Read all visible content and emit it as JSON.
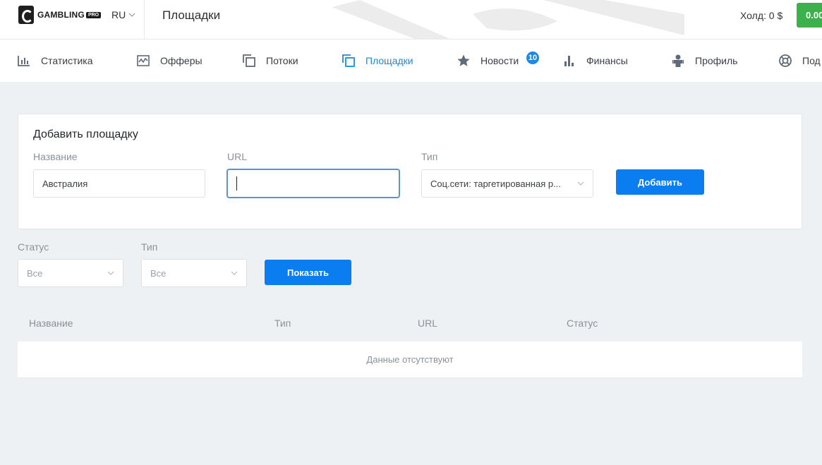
{
  "header": {
    "logo_text": "GAMBLING",
    "logo_badge": "PRO",
    "lang": "RU",
    "page_title": "Площадки",
    "hold": "Холд: 0 $",
    "balance": "0.00"
  },
  "nav": {
    "items": [
      {
        "label": "Статистика",
        "icon": "bar-chart-icon"
      },
      {
        "label": "Офферы",
        "icon": "chart-window-icon"
      },
      {
        "label": "Потоки",
        "icon": "copy-squares-icon"
      },
      {
        "label": "Площадки",
        "icon": "copy-squares-icon",
        "active": true
      },
      {
        "label": "Новости",
        "icon": "star-icon",
        "badge": "10"
      },
      {
        "label": "Финансы",
        "icon": "bars-icon"
      },
      {
        "label": "Профиль",
        "icon": "user-icon"
      },
      {
        "label": "Под",
        "icon": "lifebuoy-icon"
      }
    ]
  },
  "add_form": {
    "title": "Добавить площадку",
    "name_label": "Название",
    "name_value": "Австралия",
    "url_label": "URL",
    "url_value": "",
    "type_label": "Тип",
    "type_value": "Соц.сети: таргетированная р...",
    "submit": "Добавить"
  },
  "filters": {
    "status_label": "Статус",
    "status_value": "Все",
    "type_label": "Тип",
    "type_value": "Все",
    "show_button": "Показать"
  },
  "table": {
    "columns": [
      "Название",
      "Тип",
      "URL",
      "Статус"
    ],
    "empty_text": "Данные отсутствуют"
  },
  "colors": {
    "accent": "#1e88e5",
    "primary_button": "#0a7ef0",
    "balance_button": "#3cb04a",
    "page_bg": "#eef1f4"
  }
}
